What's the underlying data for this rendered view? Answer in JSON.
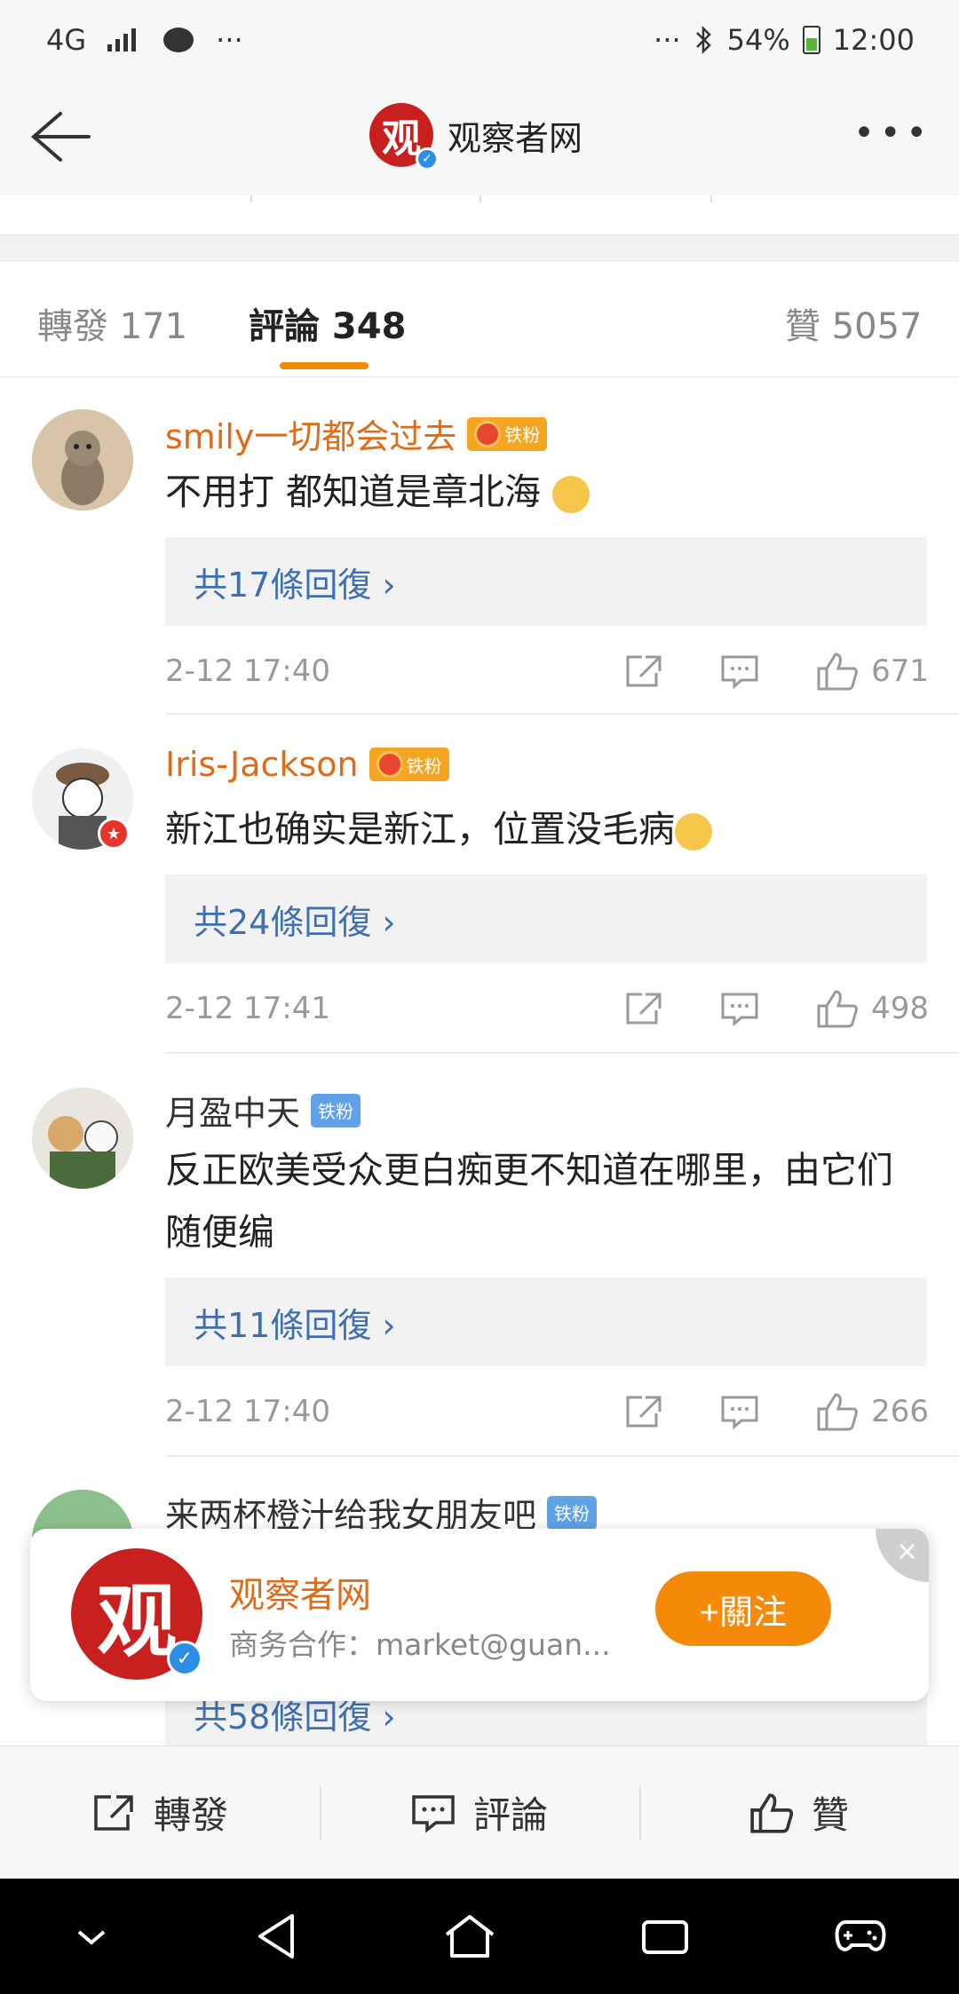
{
  "status_bar": {
    "network": "4G",
    "battery": "54%",
    "time": "12:00",
    "more": "···"
  },
  "nav": {
    "title": "观察者网",
    "logo_char": "观",
    "more": "•••"
  },
  "tabs": [
    {
      "label": "轉發 171"
    },
    {
      "label": "評論 348"
    },
    {
      "label": "贊 5057"
    }
  ],
  "comments": [
    {
      "username": "smily一切都会过去",
      "badge": "铁粉",
      "content": "不用打 都知道是章北海",
      "replies": "共17條回復 ›",
      "time": "2-12 17:40",
      "likes": "671"
    },
    {
      "username": "Iris-Jackson",
      "badge": "铁粉",
      "content": "新江也确实是新江，位置没毛病",
      "replies": "共24條回復 ›",
      "time": "2-12 17:41",
      "likes": "498"
    },
    {
      "username": "月盈中天",
      "badge": "铁粉",
      "content": "反正欧美受众更白痴更不知道在哪里，由它们随便编",
      "replies": "共11條回復 ›",
      "time": "2-12 17:40",
      "likes": "266"
    },
    {
      "username": "来两杯橙汁给我女朋友吧",
      "badge": "铁粉",
      "replies": "共58條回復 ›"
    }
  ],
  "card": {
    "name": "观察者网",
    "subtitle": "商务合作：market@guan...",
    "follow": "+關注",
    "close": "×"
  },
  "actions": {
    "repost": "轉發",
    "comment": "評論",
    "like": "贊"
  }
}
